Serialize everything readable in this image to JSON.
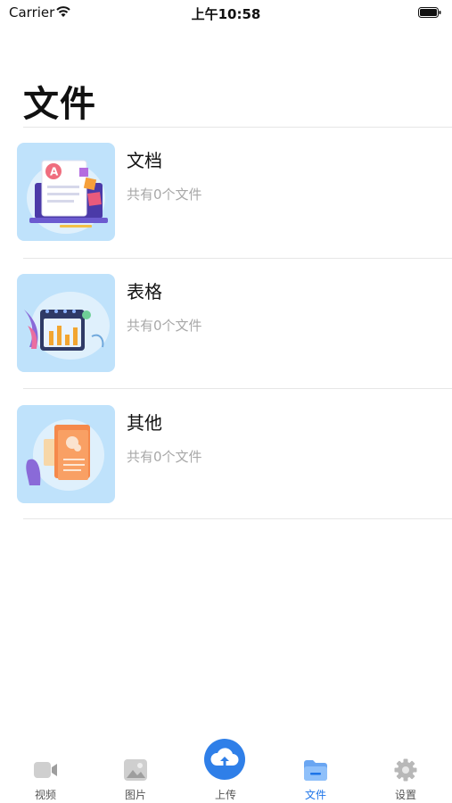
{
  "status_bar": {
    "carrier": "Carrier",
    "time": "上午10:58"
  },
  "page": {
    "title": "文件"
  },
  "categories": [
    {
      "title": "文档",
      "subtitle": "共有0个文件",
      "icon": "document-illustration-icon"
    },
    {
      "title": "表格",
      "subtitle": "共有0个文件",
      "icon": "spreadsheet-illustration-icon"
    },
    {
      "title": "其他",
      "subtitle": "共有0个文件",
      "icon": "other-files-illustration-icon"
    }
  ],
  "tabbar": {
    "items": [
      {
        "label": "视频",
        "icon": "video-icon"
      },
      {
        "label": "图片",
        "icon": "image-icon"
      },
      {
        "label": "上传",
        "icon": "cloud-upload-icon"
      },
      {
        "label": "文件",
        "icon": "folder-icon",
        "active": true
      },
      {
        "label": "设置",
        "icon": "gear-icon"
      }
    ],
    "active_color": "#1d74e8",
    "accent": "#2f7fe8"
  }
}
